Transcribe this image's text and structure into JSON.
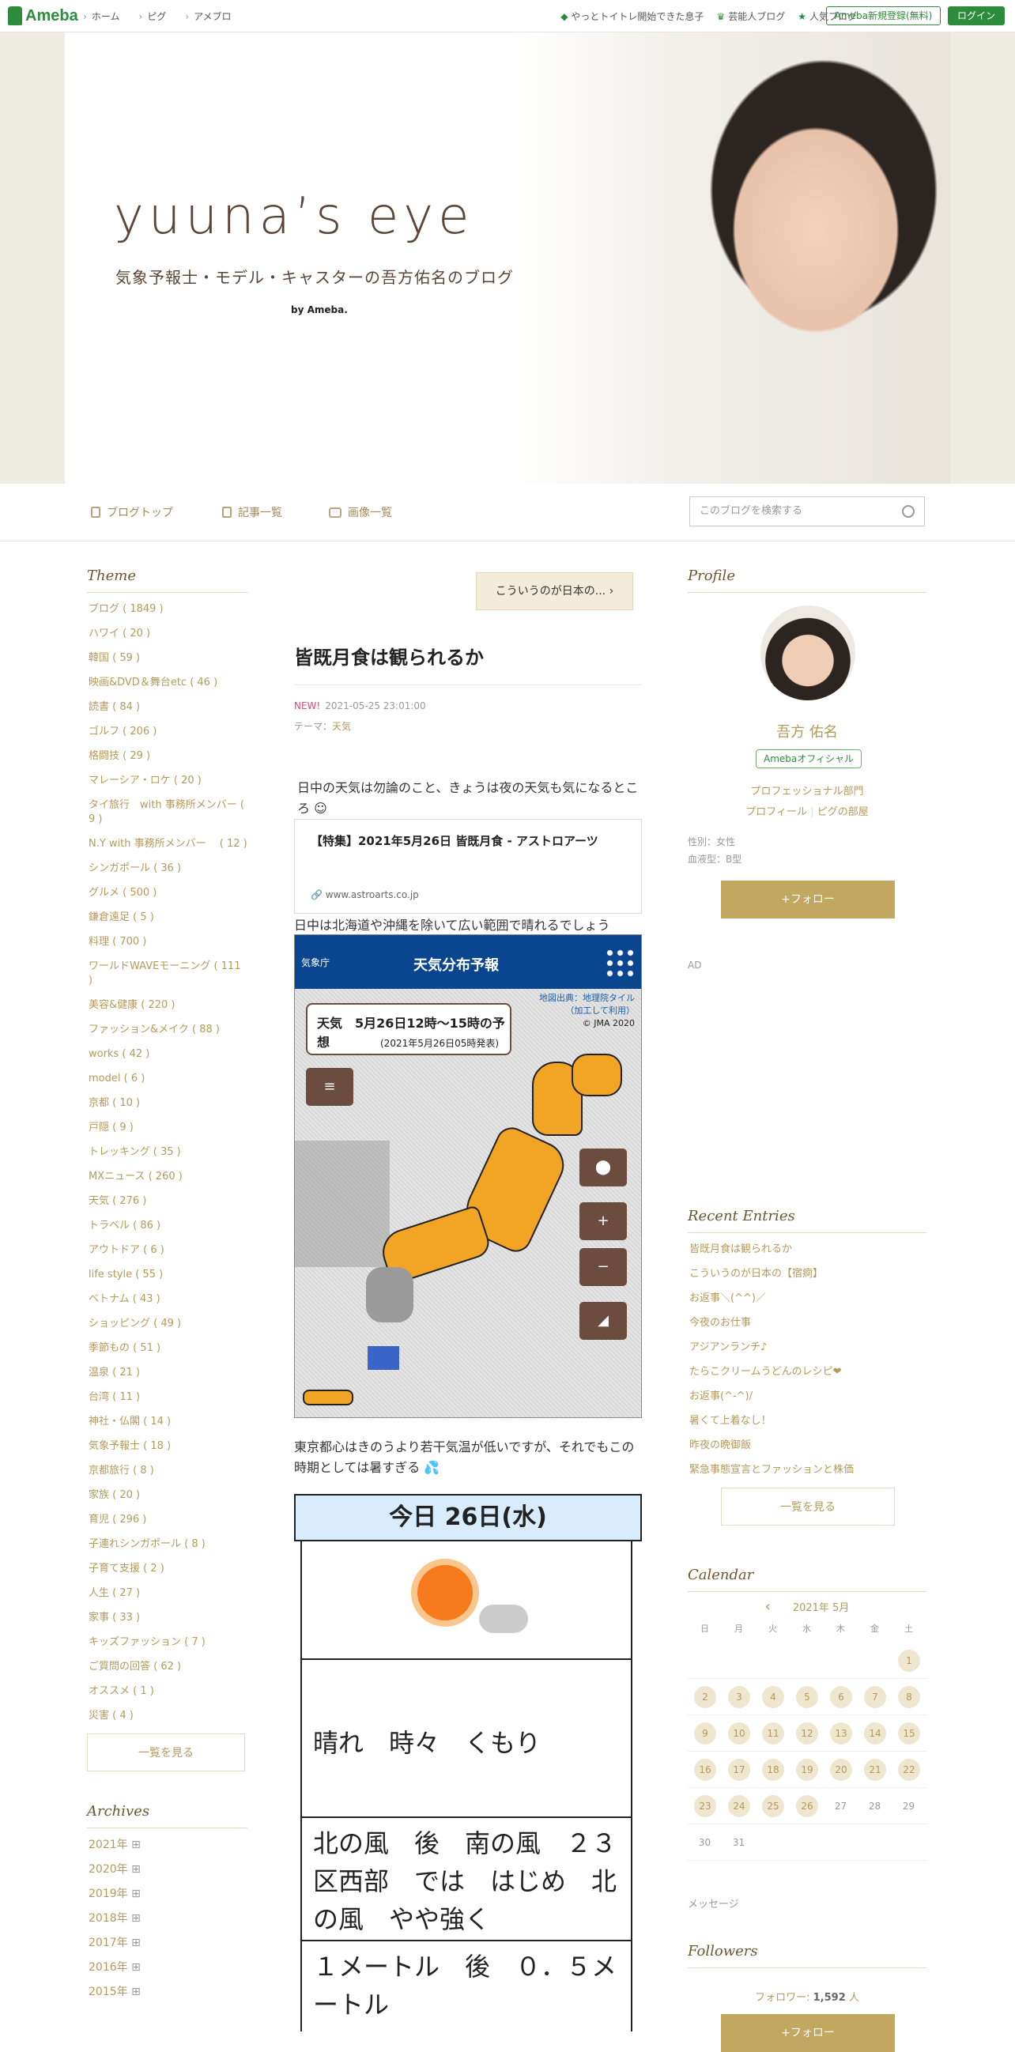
{
  "topbar": {
    "logo": "Ameba",
    "nav": [
      "ホーム",
      "ピグ",
      "アメブロ"
    ],
    "right_links": [
      "やっとトイトレ開始できた息子",
      "芸能人ブログ",
      "人気ブログ"
    ],
    "register": "Ameba新規登録(無料)",
    "login": "ログイン"
  },
  "header": {
    "title": "yuuna’s eye",
    "subtitle": "気象予報士・モデル・キャスターの吾方佑名のブログ",
    "by": "by Ameba."
  },
  "blognav": {
    "items": [
      "ブログトップ",
      "記事一覧",
      "画像一覧"
    ],
    "search_placeholder": "このブログを検索する"
  },
  "sidebar_left": {
    "theme_heading": "Theme",
    "themes": [
      "ブログ ( 1849 )",
      "ハワイ ( 20 )",
      "韓国 ( 59 )",
      "映画&DVD＆舞台etc ( 46 )",
      "読書 ( 84 )",
      "ゴルフ ( 206 )",
      "格闘技 ( 29 )",
      "マレーシア・ロケ ( 20 )",
      "タイ旅行　with 事務所メンバー ( 9 )",
      "N.Y with 事務所メンバー　 ( 12 )",
      "シンガポール ( 36 )",
      "グルメ ( 500 )",
      "鎌倉遠足 ( 5 )",
      "料理 ( 700 )",
      "ワールドWAVEモーニング ( 111 )",
      "美容&健康 ( 220 )",
      "ファッション&メイク ( 88 )",
      "works ( 42 )",
      "model ( 6 )",
      "京都 ( 10 )",
      "戸隠 ( 9 )",
      "トレッキング ( 35 )",
      "MXニュース ( 260 )",
      "天気 ( 276 )",
      "トラベル ( 86 )",
      "アウトドア ( 6 )",
      "life style ( 55 )",
      "ベトナム ( 43 )",
      "ショッピング ( 49 )",
      "季節もの ( 51 )",
      "温泉 ( 21 )",
      "台湾 ( 11 )",
      "神社・仏閣 ( 14 )",
      "気象予報士 ( 18 )",
      "京都旅行 ( 8 )",
      "家族 ( 20 )",
      "育児 ( 296 )",
      "子連れシンガポール ( 8 )",
      "子育て支援 ( 2 )",
      "人生 ( 27 )",
      "家事 ( 33 )",
      "キッズファッション ( 7 )",
      "ご質問の回答 ( 62 )",
      "オススメ ( 1 )",
      "災害 ( 4 )"
    ],
    "see_all": "一覧を見る",
    "archives_heading": "Archives",
    "archives": [
      "2021年",
      "2020年",
      "2019年",
      "2018年",
      "2017年",
      "2016年",
      "2015年"
    ]
  },
  "article": {
    "prev_button": "こういうのが日本の...",
    "title": "皆既月食は観られるか",
    "new_label": "NEW!",
    "datetime": "2021-05-25 23:01:00",
    "theme_label": "テーマ：",
    "theme_value": "天気",
    "para1": "日中の天気は勿論のこと、きょうは夜の天気も気になるところ",
    "card_title": "【特集】2021年5月26日 皆既月食 - アストロアーツ",
    "card_url": "www.astroarts.co.jp",
    "para2": "日中は北海道や沖縄を除いて広い範囲で晴れるでしょう",
    "map": {
      "agency": "気象庁",
      "title": "天気分布予報",
      "info_title": "天気　5月26日12時〜15時の予想",
      "info_sub": "(2021年5月26日05時発表)",
      "credit1": "地図出典：地理院タイル",
      "credit2": "（加工して利用）",
      "credit3": "© JMA 2020"
    },
    "para3": "東京都心はきのうより若干気温が低いですが、それでもこの時期としては暑すぎる",
    "forecast": {
      "header": "今日 26日(水)",
      "weather": "晴れ　時々　くもり",
      "wind": "北の風　後　南の風　２３区西部　では　はじめ　北の風　やや強く",
      "wave": "１メートル　後　０．５メートル"
    }
  },
  "sidebar_right": {
    "profile_heading": "Profile",
    "name": "吾方 佑名",
    "badge": "Amebaオフィシャル",
    "link1": "プロフェッショナル部門",
    "link2": "プロフィール",
    "link3": "ピグの部屋",
    "gender": "性別：女性",
    "blood": "血液型：B型",
    "follow": "+フォロー",
    "ad": "AD",
    "recent_heading": "Recent Entries",
    "recent": [
      "皆既月食は観られるか",
      "こういうのが日本の【宿痾】",
      "お返事＼(^^)／",
      "今夜のお仕事",
      "アジアンランチ♪",
      "たらこクリームうどんのレシピ❤",
      "お返事(^-^)/",
      "暑くて上着なし！",
      "昨夜の晩御飯",
      "緊急事態宣言とファッションと株価"
    ],
    "see_all": "一覧を見る",
    "calendar_heading": "Calendar",
    "month": "2021年 5月",
    "dow": [
      "日",
      "月",
      "火",
      "水",
      "木",
      "金",
      "土"
    ],
    "message": "メッセージ",
    "followers_heading": "Followers",
    "follower_label": "フォロワー: ",
    "follower_count": "1,592",
    "follower_unit": " 人"
  }
}
